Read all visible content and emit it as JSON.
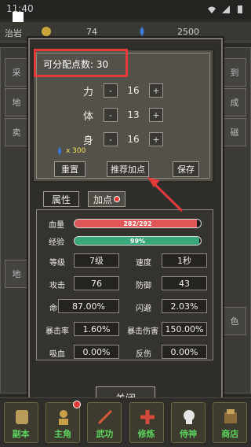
{
  "status_bar": {
    "time": "11:40"
  },
  "top_bar": {
    "left_label": "治岩",
    "coin_value": "74",
    "gem_value": "2500"
  },
  "background_sides": {
    "left": [
      "采",
      "地",
      "卖",
      "地"
    ],
    "right": [
      "到",
      "成",
      "磁",
      "色"
    ]
  },
  "alloc": {
    "points_label": "可分配点数: 30",
    "stats": [
      {
        "name": "力",
        "minus": "-",
        "value": "16",
        "plus": "+"
      },
      {
        "name": "体",
        "minus": "-",
        "value": "13",
        "plus": "+"
      },
      {
        "name": "身",
        "minus": "-",
        "value": "16",
        "plus": "+"
      }
    ],
    "gem_cost": "x 300",
    "reset_label": "重置",
    "recommend_label": "推荐加点",
    "save_label": "保存"
  },
  "tabs": {
    "attr_label": "属性",
    "points_label": "加点"
  },
  "bars": {
    "hp": {
      "label": "血量",
      "text": "282/292",
      "fraction": 0.966,
      "color": "#e05555"
    },
    "exp": {
      "label": "经验",
      "text": "99%",
      "fraction": 0.99,
      "color": "#3aa87a"
    }
  },
  "attributes": [
    {
      "left_label": "等级",
      "left_value": "7级",
      "right_label": "速度",
      "right_value": "1秒"
    },
    {
      "left_label": "攻击",
      "left_value": "76",
      "right_label": "防御",
      "right_value": "43"
    },
    {
      "left_label": "命中",
      "left_value": "87.00%",
      "right_label": "闪避",
      "right_value": "2.03%"
    },
    {
      "left_label": "暴击率",
      "left_value": "1.60%",
      "right_label": "暴击伤害",
      "right_value": "150.00%"
    },
    {
      "left_label": "吸血",
      "left_value": "0.00%",
      "right_label": "反伤",
      "right_value": "0.00%"
    }
  ],
  "close_label": "关闭",
  "bottom_nav": [
    {
      "label": "副本",
      "icon": "scroll-icon",
      "dot": false
    },
    {
      "label": "主角",
      "icon": "hero-icon",
      "dot": true
    },
    {
      "label": "武功",
      "icon": "sword-icon",
      "dot": false
    },
    {
      "label": "修炼",
      "icon": "cross-icon",
      "dot": false
    },
    {
      "label": "侍神",
      "icon": "skull-icon",
      "dot": false
    },
    {
      "label": "商店",
      "icon": "shop-icon",
      "dot": false
    }
  ],
  "colors": {
    "highlight": "#e33a3a",
    "nav_label": "#5cd35c",
    "gem_text": "#f2e05a"
  }
}
